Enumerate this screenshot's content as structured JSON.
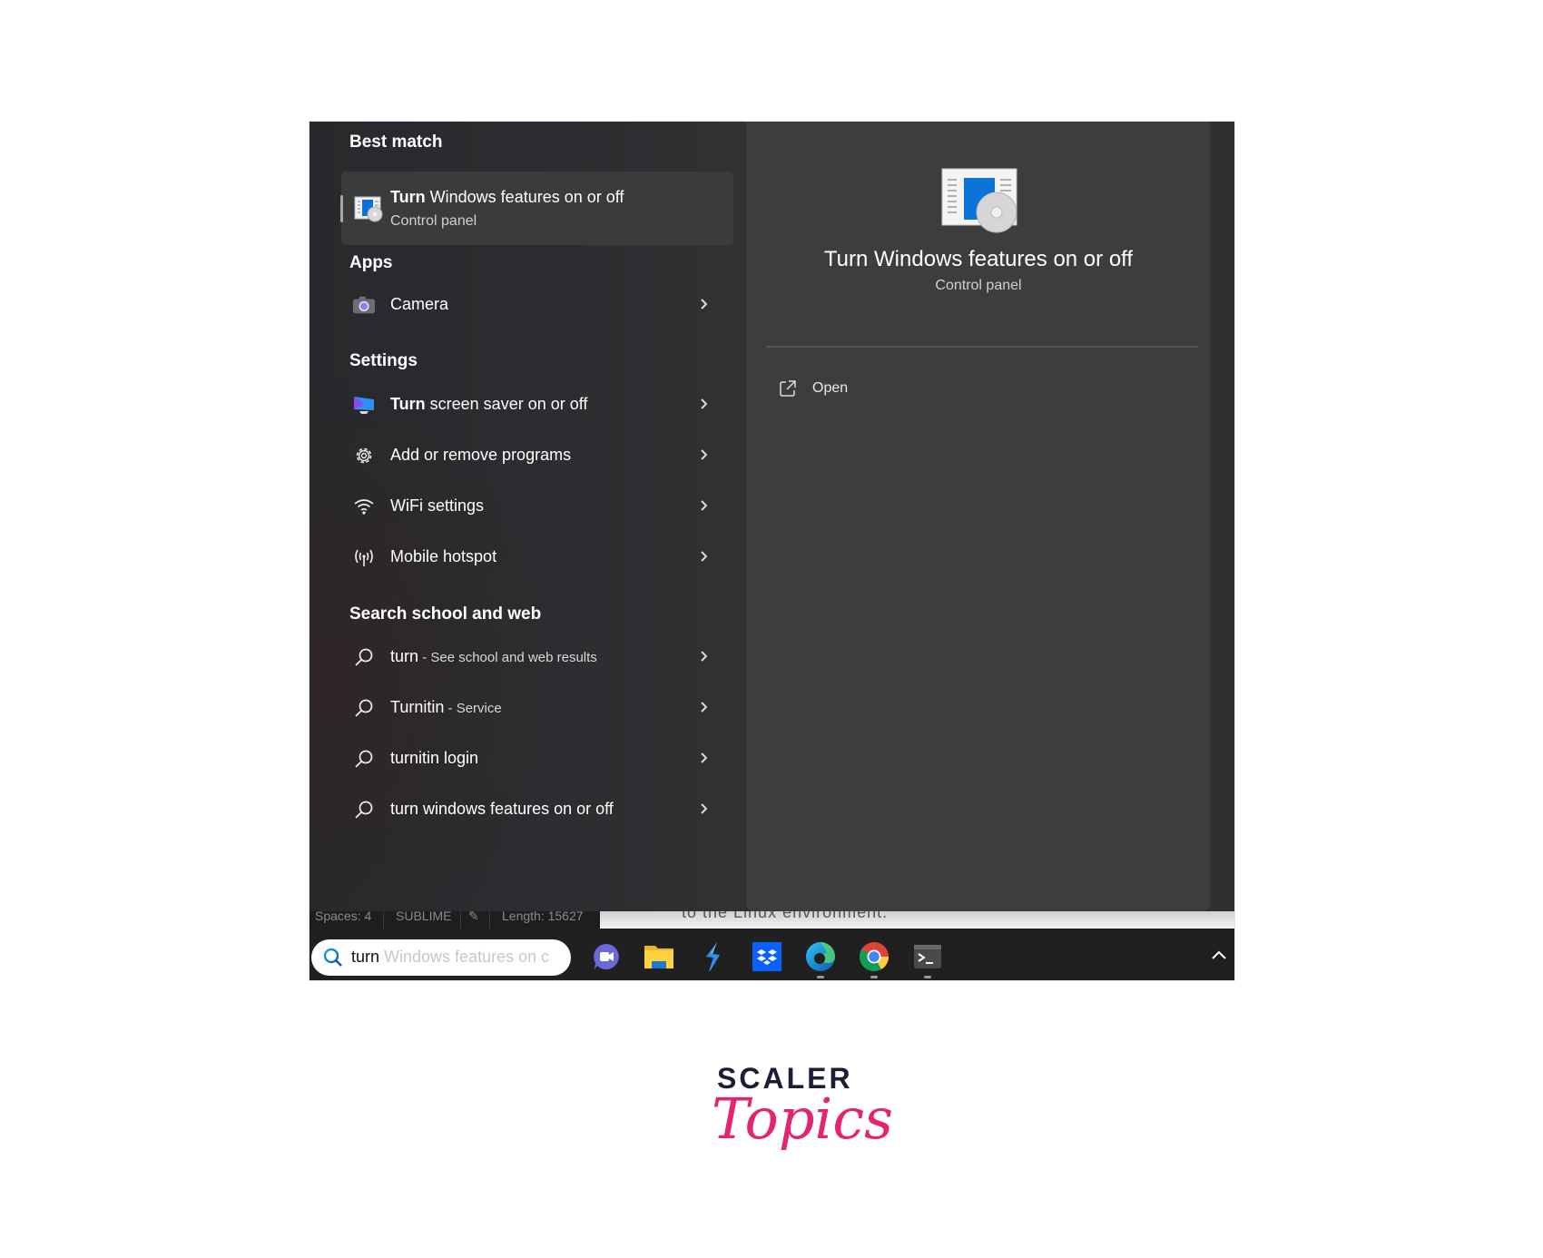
{
  "start_menu": {
    "left": {
      "best_match": {
        "heading": "Best match",
        "title_bold": "Turn",
        "title_rest": " Windows features on or off",
        "subtitle": "Control panel",
        "icon": "windows-features-icon"
      },
      "apps": {
        "heading": "Apps",
        "items": [
          {
            "label": "Camera",
            "icon": "camera-icon"
          }
        ]
      },
      "settings": {
        "heading": "Settings",
        "items": [
          {
            "bold": "Turn",
            "rest": " screen saver on or off",
            "icon": "screen-saver-icon"
          },
          {
            "bold": "",
            "rest": "Add or remove programs",
            "icon": "gear-icon"
          },
          {
            "bold": "",
            "rest": "WiFi settings",
            "icon": "wifi-icon"
          },
          {
            "bold": "",
            "rest": "Mobile hotspot",
            "icon": "hotspot-icon"
          }
        ]
      },
      "web": {
        "heading": "Search school and web",
        "items": [
          {
            "main": "turn",
            "dim": " - See school and web results",
            "icon": "search-icon"
          },
          {
            "main": "Turnitin",
            "dim": " - Service",
            "icon": "search-icon"
          },
          {
            "main": "turnitin login",
            "dim": "",
            "icon": "search-icon"
          },
          {
            "main": "turn windows features on or off",
            "dim": "",
            "icon": "search-icon"
          }
        ]
      }
    },
    "right": {
      "title": "Turn Windows features on or off",
      "subtitle": "Control panel",
      "actions": [
        {
          "label": "Open",
          "icon": "open-external-icon"
        }
      ]
    }
  },
  "background": {
    "statusbar": {
      "spaces": "Spaces: 4",
      "syntax": "SUBLIME",
      "length": "Length: 15627"
    },
    "doc_text": "to the Linux environment."
  },
  "taskbar": {
    "search": {
      "typed": "turn",
      "suggestion": " Windows features on c"
    },
    "apps": [
      {
        "name": "Teams Meet",
        "icon": "video-chat-icon",
        "running": false
      },
      {
        "name": "File Explorer",
        "icon": "folder-icon",
        "running": false
      },
      {
        "name": "Power Automate",
        "icon": "lightning-icon",
        "running": false
      },
      {
        "name": "Dropbox",
        "icon": "dropbox-icon",
        "running": false
      },
      {
        "name": "Microsoft Edge",
        "icon": "edge-icon",
        "running": true
      },
      {
        "name": "Google Chrome",
        "icon": "chrome-icon",
        "running": true
      },
      {
        "name": "Terminal",
        "icon": "terminal-icon",
        "running": true
      }
    ]
  },
  "branding": {
    "line1": "SCALER",
    "line2": "Topics",
    "colors": {
      "dark": "#1a1f36",
      "pink": "#e4246f"
    }
  }
}
